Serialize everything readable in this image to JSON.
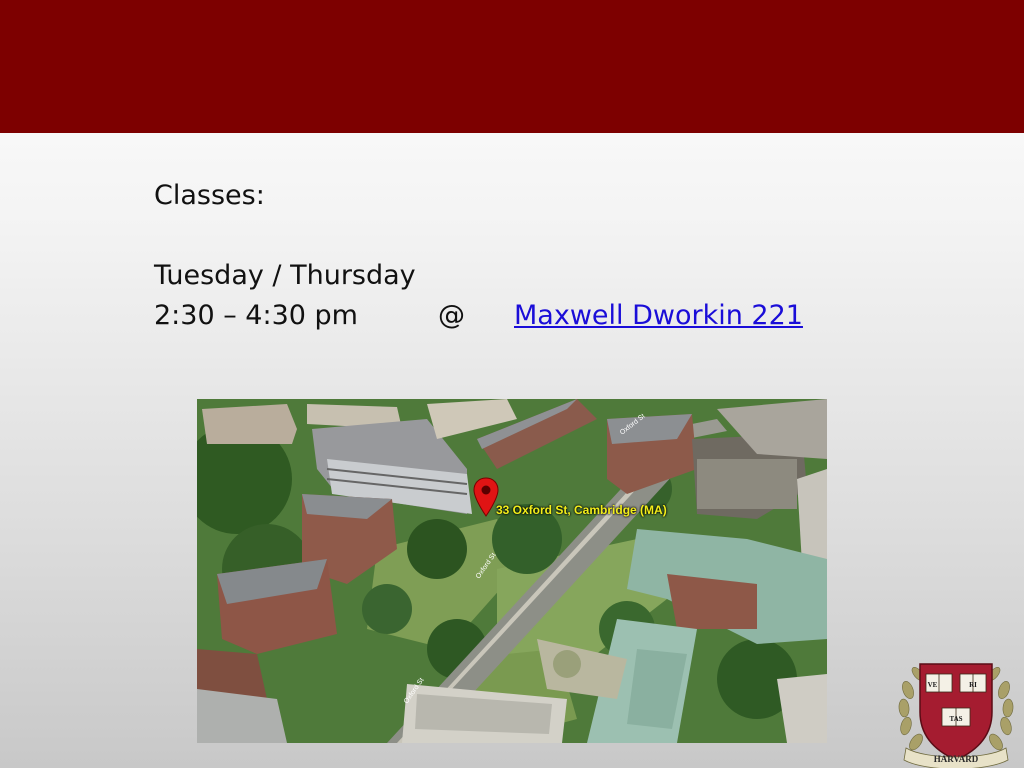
{
  "slide": {
    "heading": "Classes:",
    "days": "Tuesday / Thursday",
    "time": "2:30 – 4:30 pm",
    "at": "@",
    "location": "Maxwell Dworkin 221"
  },
  "map": {
    "address_label": "33 Oxford St, Cambridge (MA)",
    "street_labels": [
      "Oxford St",
      "Oxford St",
      "Oxford St"
    ]
  },
  "seal": {
    "book_1": "VE",
    "book_2": "RI",
    "book_3": "TAS",
    "banner": "HARVARD"
  },
  "colors": {
    "header": "#7d0000",
    "link": "#1a0dd8",
    "label": "#f2ee1a"
  }
}
